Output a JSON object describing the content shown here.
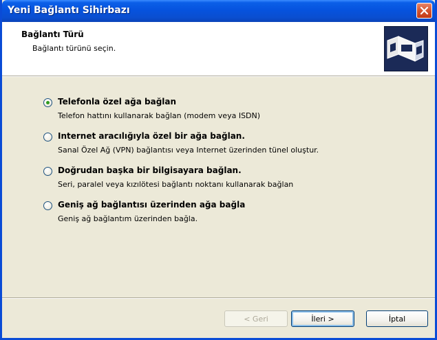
{
  "window": {
    "title": "Yeni Bağlantı Sihirbazı",
    "close_icon": "close-icon"
  },
  "header": {
    "title": "Bağlantı Türü",
    "subtitle": "Bağlantı türünü seçin.",
    "icon": "network-connection-icon"
  },
  "options": [
    {
      "label": "Telefonla özel ağa bağlan",
      "description": "Telefon hattını kullanarak bağlan (modem veya ISDN)",
      "selected": true
    },
    {
      "label": "Internet aracılığıyla özel bir ağa bağlan.",
      "description": "Sanal Özel Ağ (VPN) bağlantısı veya Internet üzerinden tünel oluştur.",
      "selected": false
    },
    {
      "label": "Doğrudan başka bir bilgisayara bağlan.",
      "description": "Seri, paralel veya kızılötesi bağlantı noktanı kullanarak bağlan",
      "selected": false
    },
    {
      "label": "Geniş ağ bağlantısı üzerinden ağa bağla",
      "description": "Geniş ağ bağlantım üzerinden bağla.",
      "selected": false
    }
  ],
  "buttons": {
    "back": "< Geri",
    "next": "İleri >",
    "cancel": "İptal"
  },
  "colors": {
    "titlebar": "#0653de",
    "selected_radio": "#2f9a1e"
  }
}
